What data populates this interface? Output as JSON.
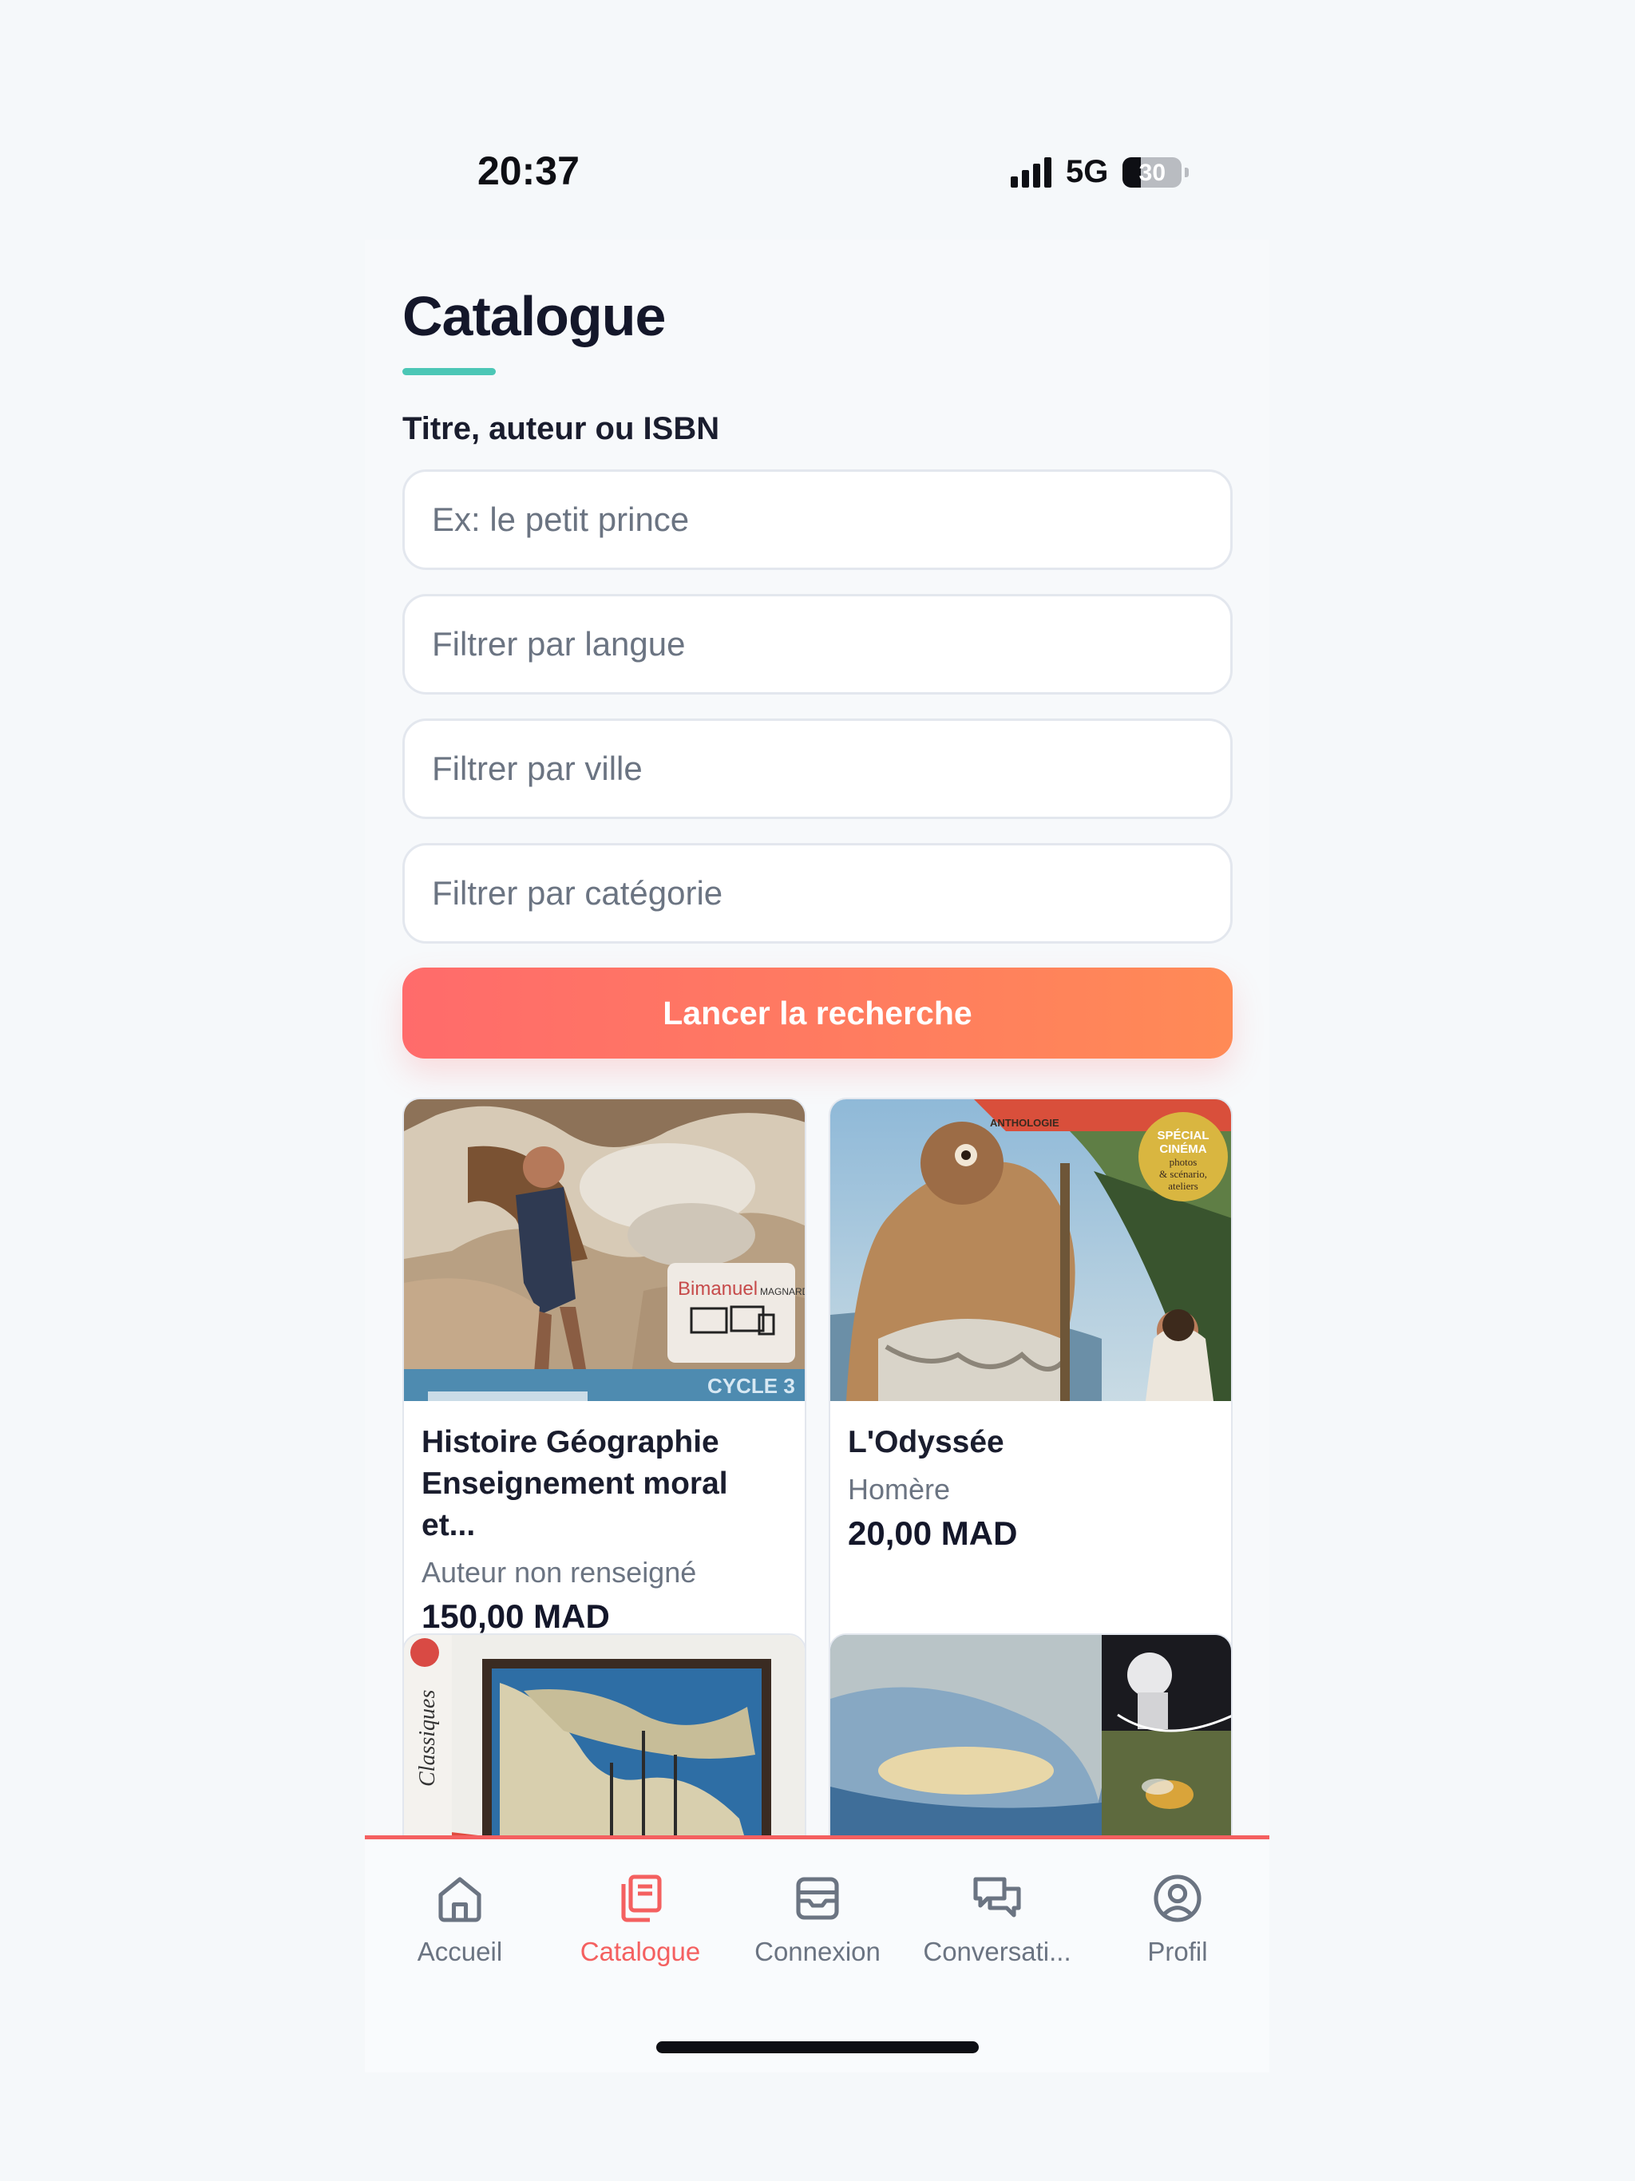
{
  "status_bar": {
    "time": "20:37",
    "network": "5G",
    "battery_level": "30"
  },
  "page": {
    "title": "Catalogue"
  },
  "search": {
    "label": "Titre, auteur ou ISBN",
    "query_placeholder": "Ex: le petit prince",
    "language_placeholder": "Filtrer par langue",
    "city_placeholder": "Filtrer par ville",
    "category_placeholder": "Filtrer par catégorie",
    "button_label": "Lancer la recherche"
  },
  "books": [
    {
      "title": "Histoire Géographie Enseignement moral et...",
      "author": "Auteur non renseigné",
      "price": "150,00 MAD"
    },
    {
      "title": "L'Odyssée",
      "author": "Homère",
      "price": "20,00 MAD"
    },
    {
      "title": "",
      "author": "",
      "price": ""
    },
    {
      "title": "",
      "author": "",
      "price": ""
    }
  ],
  "covers": {
    "book1": {
      "brand": "Bimanuel",
      "publisher": "MAGNARD",
      "level": "CYCLE 3"
    },
    "book2": {
      "series": "ANTHOLOGIE",
      "badge": [
        "SPÉCIAL",
        "CINÉMA",
        "photos",
        "& scénario,",
        "ateliers"
      ]
    },
    "book3": {
      "series": "Classiques"
    }
  },
  "nav": {
    "tabs": [
      {
        "label": "Accueil",
        "icon": "home-icon"
      },
      {
        "label": "Catalogue",
        "icon": "books-icon",
        "active": true
      },
      {
        "label": "Connexion",
        "icon": "inbox-icon"
      },
      {
        "label": "Conversati...",
        "icon": "chat-icon"
      },
      {
        "label": "Profil",
        "icon": "profile-icon"
      }
    ]
  },
  "colors": {
    "accent": "#f46060",
    "teal": "#4cc7b6",
    "button_start": "#ff6b6b",
    "button_end": "#ff8a56"
  }
}
